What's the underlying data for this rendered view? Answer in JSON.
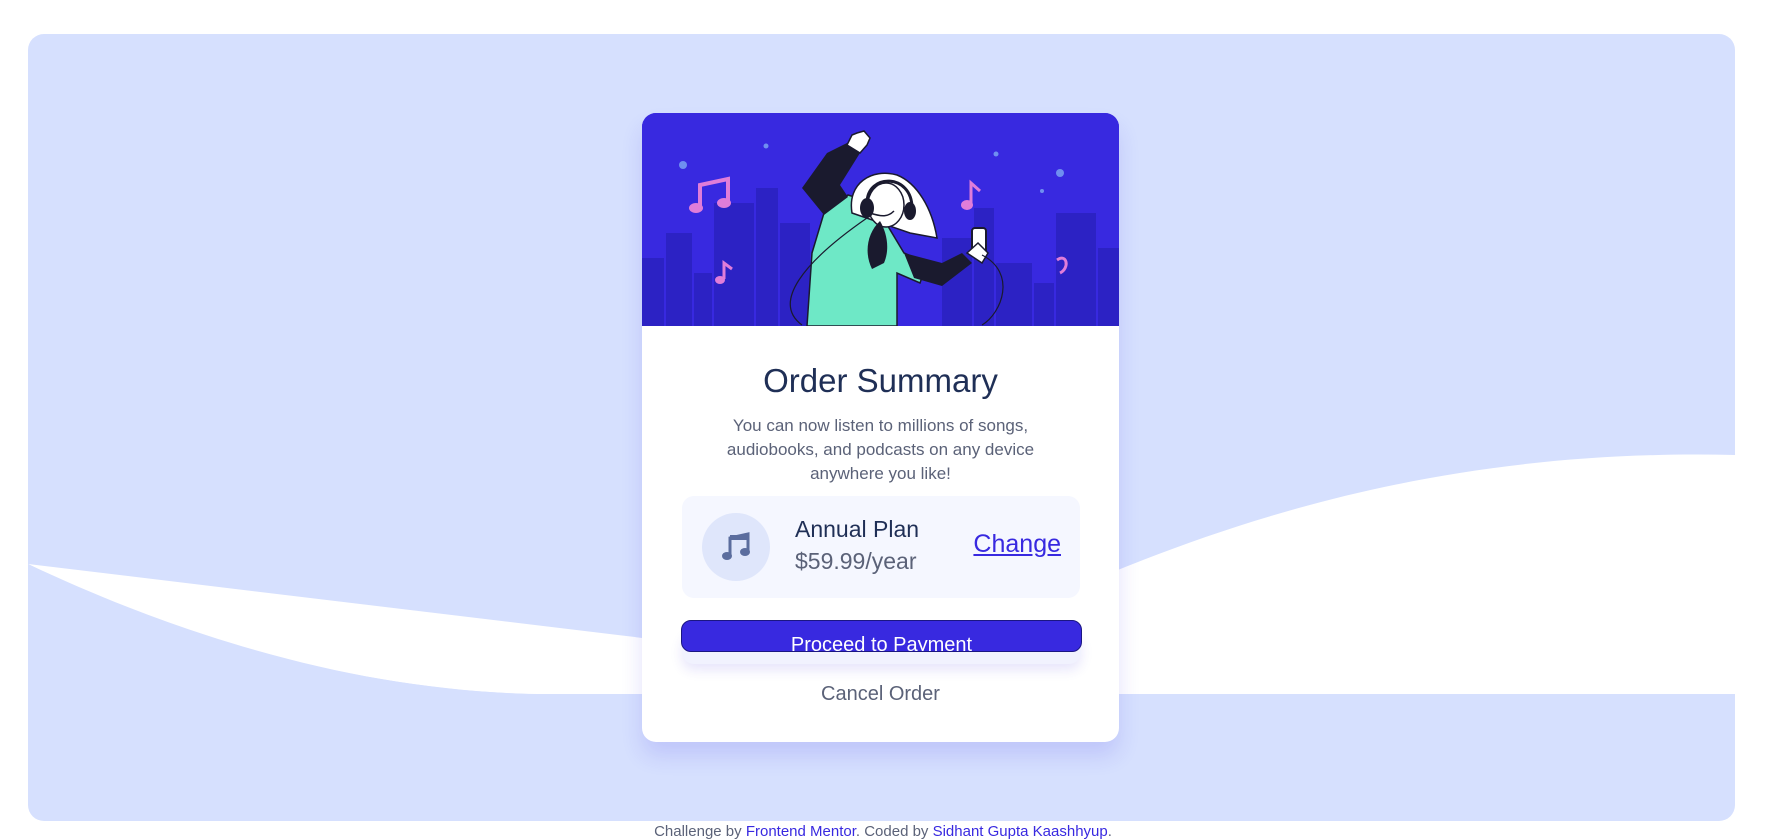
{
  "colors": {
    "background_panel": "#d6e0fe",
    "primary": "#3829e0",
    "card": "#ffffff",
    "plan_box": "#f5f7ff",
    "dark_text": "#1f2f56",
    "muted_text": "#5b6278"
  },
  "card": {
    "hero_image": "woman-dancing-with-headphones-illustration",
    "title": "Order Summary",
    "description": "You can now listen to millions of songs, audiobooks, and podcasts on any device anywhere you like!",
    "plan": {
      "icon": "music-note-icon",
      "name": "Annual Plan",
      "price": "$59.99/year",
      "change_label": "Change"
    },
    "proceed_label": "Proceed to Payment",
    "cancel_label": "Cancel Order"
  },
  "attribution": {
    "prefix": "Challenge by",
    "frontend_mentor": "Frontend Mentor",
    "middle": ". Coded by",
    "author": "Sidhant Gupta Kaashhyup",
    "suffix": "."
  }
}
